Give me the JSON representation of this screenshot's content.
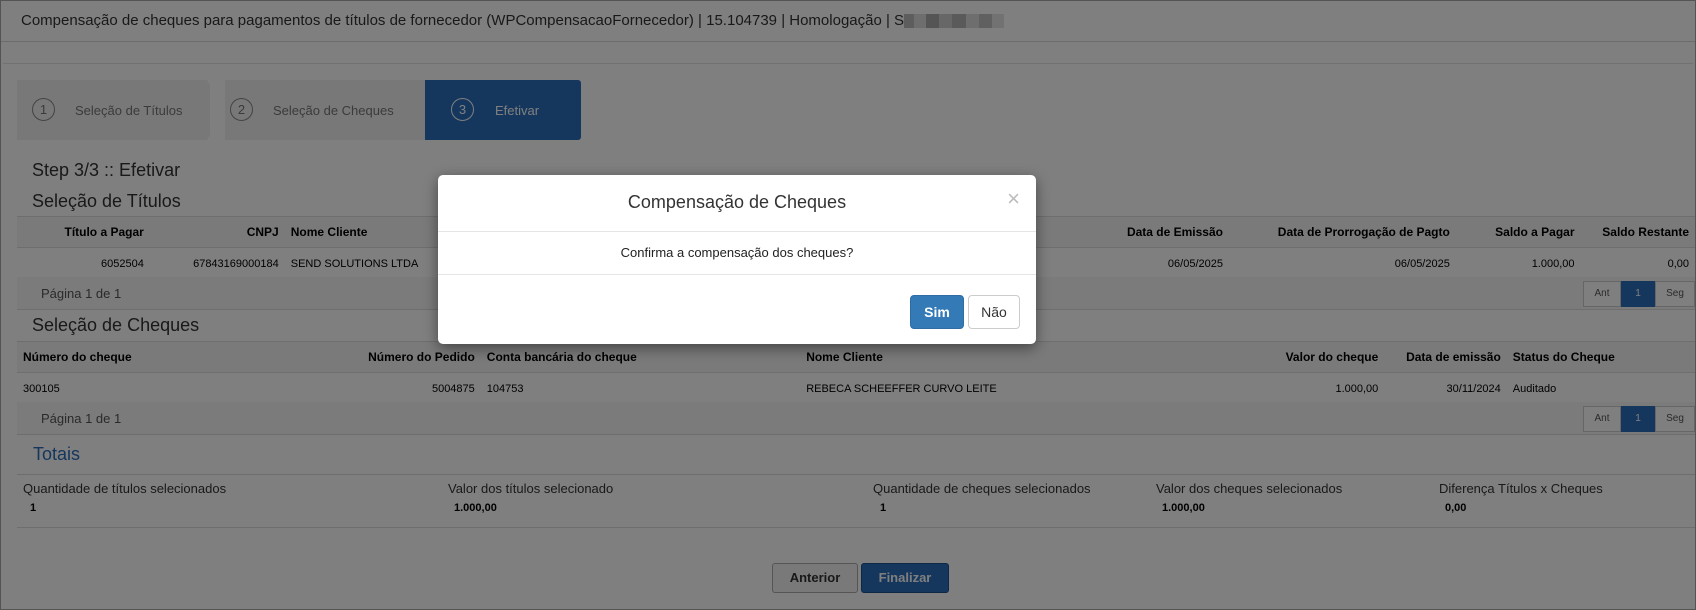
{
  "window": {
    "title": "Compensação de cheques para pagamentos de títulos de fornecedor (WPCompensacaoFornecedor) | 15.104739 | Homologação | S"
  },
  "wizard": {
    "steps": [
      {
        "num": "1",
        "label": "Seleção de Títulos"
      },
      {
        "num": "2",
        "label": "Seleção de Cheques"
      },
      {
        "num": "3",
        "label": "Efetivar"
      }
    ]
  },
  "step_heading": "Step 3/3 :: Efetivar",
  "titulos": {
    "heading": "Seleção de Títulos",
    "columns": [
      "Título a Pagar",
      "CNPJ",
      "Nome Cliente",
      "Data de Emissão",
      "Data de Prorrogação de Pagto",
      "Saldo a Pagar",
      "Saldo Restante"
    ],
    "row": [
      "6052504",
      "67843169000184",
      "SEND SOLUTIONS LTDA",
      "06/05/2025",
      "06/05/2025",
      "1.000,00",
      "0,00"
    ],
    "pager": {
      "text": "Página 1 de 1",
      "prev": "Ant",
      "current": "1",
      "next": "Seg"
    }
  },
  "cheques": {
    "heading": "Seleção de Cheques",
    "columns": [
      "Número do cheque",
      "Número do Pedido",
      "Conta bancária do cheque",
      "Nome Cliente",
      "Valor do cheque",
      "Data de emissão",
      "Status do Cheque"
    ],
    "row": [
      "300105",
      "5004875",
      "104753",
      "REBECA SCHEEFFER CURVO LEITE",
      "1.000,00",
      "30/11/2024",
      "Auditado"
    ],
    "pager": {
      "text": "Página 1 de 1",
      "prev": "Ant",
      "current": "1",
      "next": "Seg"
    }
  },
  "totais": {
    "heading": "Totais",
    "items": [
      {
        "label": "Quantidade de títulos selecionados",
        "value": "1"
      },
      {
        "label": "Valor dos títulos selecionado",
        "value": "1.000,00"
      },
      {
        "label": "Quantidade de cheques selecionados",
        "value": "1"
      },
      {
        "label": "Valor dos cheques selecionados",
        "value": "1.000,00"
      },
      {
        "label": "Diferença Títulos x Cheques",
        "value": "0,00"
      }
    ]
  },
  "buttons": {
    "anterior": "Anterior",
    "finalizar": "Finalizar"
  },
  "modal": {
    "title": "Compensação de Cheques",
    "close": "×",
    "message": "Confirma a compensação dos cheques?",
    "yes": "Sim",
    "no": "Não"
  },
  "colors": {
    "accent": "#2a6ebb",
    "overlay": "rgba(0,0,0,0.5)"
  }
}
